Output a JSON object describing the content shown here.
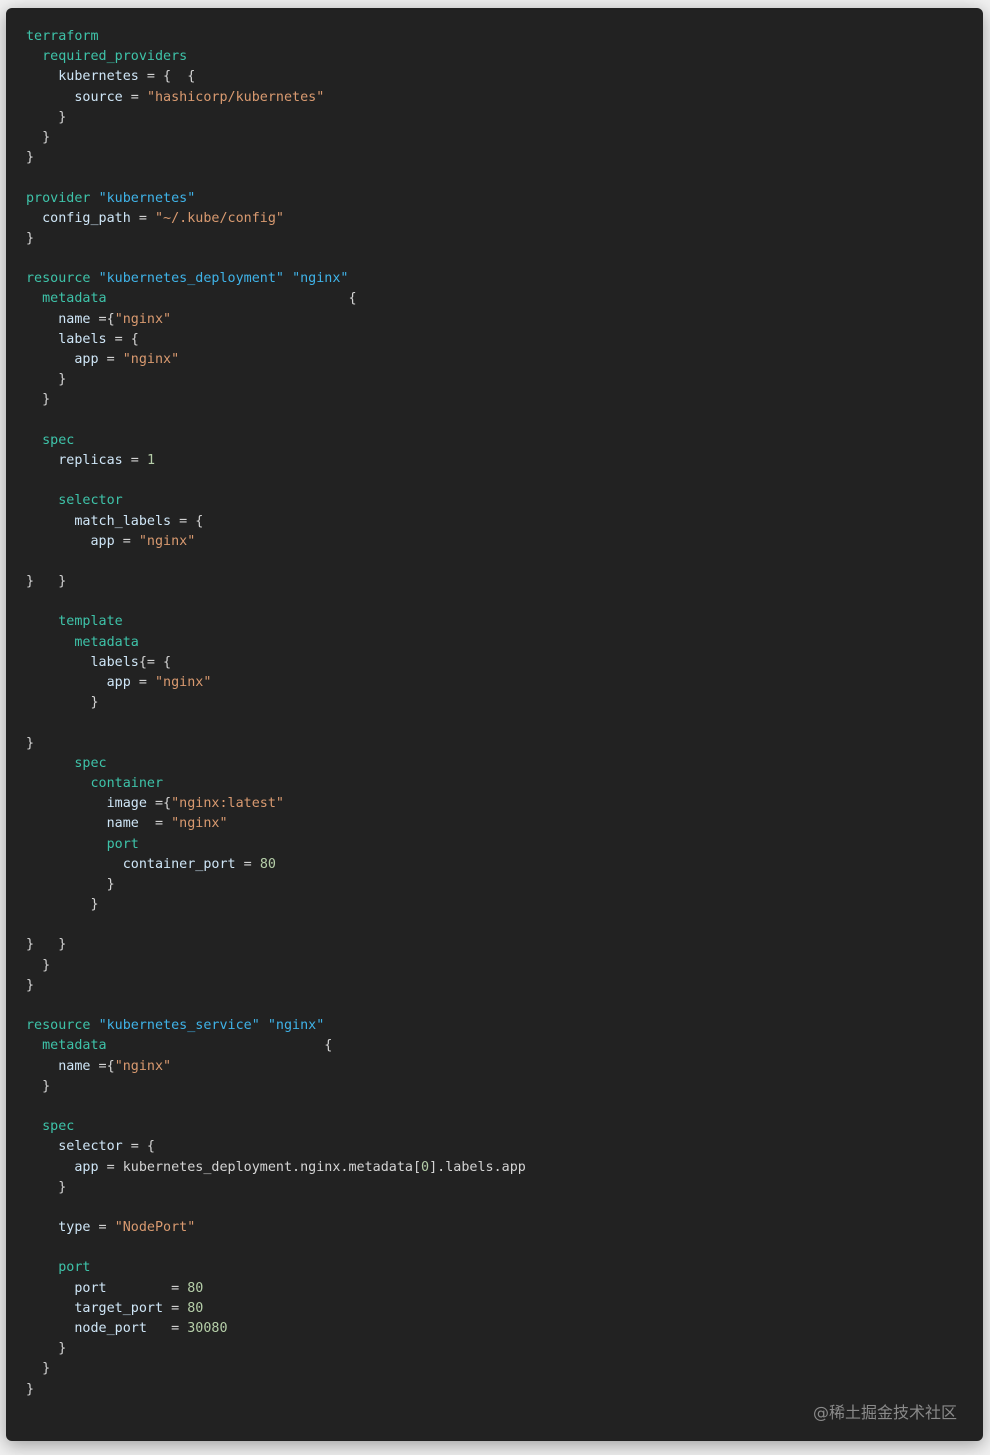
{
  "code": {
    "language": "terraform",
    "lines": [
      [
        {
          "t": "terraform",
          "c": "kw"
        }
      ],
      [
        {
          "t": "  "
        },
        {
          "t": "required_providers",
          "c": "kw"
        }
      ],
      [
        {
          "t": "    "
        },
        {
          "t": "kubernetes",
          "c": "id"
        },
        {
          "t": " = {  {",
          "c": "p"
        }
      ],
      [
        {
          "t": "      "
        },
        {
          "t": "source",
          "c": "id"
        },
        {
          "t": " = ",
          "c": "p"
        },
        {
          "t": "\"hashicorp/kubernetes\"",
          "c": "str"
        }
      ],
      [
        {
          "t": "    }",
          "c": "p"
        }
      ],
      [
        {
          "t": "  }",
          "c": "p"
        }
      ],
      [
        {
          "t": "}",
          "c": "p"
        }
      ],
      [],
      [
        {
          "t": "provider",
          "c": "kw"
        },
        {
          "t": " "
        },
        {
          "t": "\"kubernetes\"",
          "c": "lbl"
        }
      ],
      [
        {
          "t": "  "
        },
        {
          "t": "config_path",
          "c": "id"
        },
        {
          "t": " = ",
          "c": "p"
        },
        {
          "t": "\"~/.kube/config\"",
          "c": "str"
        }
      ],
      [
        {
          "t": "}",
          "c": "p"
        }
      ],
      [],
      [
        {
          "t": "resource",
          "c": "kw"
        },
        {
          "t": " "
        },
        {
          "t": "\"kubernetes_deployment\"",
          "c": "lbl"
        },
        {
          "t": " "
        },
        {
          "t": "\"nginx\"",
          "c": "lbl"
        }
      ],
      [
        {
          "t": "  "
        },
        {
          "t": "metadata",
          "c": "kw"
        },
        {
          "t": "                              {",
          "c": "p"
        }
      ],
      [
        {
          "t": "    "
        },
        {
          "t": "name",
          "c": "id"
        },
        {
          "t": " ={",
          "c": "p"
        },
        {
          "t": "\"nginx\"",
          "c": "str"
        }
      ],
      [
        {
          "t": "    "
        },
        {
          "t": "labels",
          "c": "id"
        },
        {
          "t": " = {",
          "c": "p"
        }
      ],
      [
        {
          "t": "      "
        },
        {
          "t": "app",
          "c": "id"
        },
        {
          "t": " = ",
          "c": "p"
        },
        {
          "t": "\"nginx\"",
          "c": "str"
        }
      ],
      [
        {
          "t": "    }",
          "c": "p"
        }
      ],
      [
        {
          "t": "  }",
          "c": "p"
        }
      ],
      [],
      [
        {
          "t": "  "
        },
        {
          "t": "spec",
          "c": "kw"
        }
      ],
      [
        {
          "t": "    "
        },
        {
          "t": "replicas",
          "c": "id"
        },
        {
          "t": " = ",
          "c": "p"
        },
        {
          "t": "1",
          "c": "num"
        }
      ],
      [],
      [
        {
          "t": "    "
        },
        {
          "t": "selector",
          "c": "kw"
        }
      ],
      [
        {
          "t": "      "
        },
        {
          "t": "match_labels",
          "c": "id"
        },
        {
          "t": " = {",
          "c": "p"
        }
      ],
      [
        {
          "t": "        "
        },
        {
          "t": "app",
          "c": "id"
        },
        {
          "t": " = ",
          "c": "p"
        },
        {
          "t": "\"nginx\"",
          "c": "str"
        }
      ],
      [],
      [
        {
          "t": "}   }",
          "c": "p"
        }
      ],
      [],
      [
        {
          "t": "    "
        },
        {
          "t": "template",
          "c": "kw"
        }
      ],
      [
        {
          "t": "      "
        },
        {
          "t": "metadata",
          "c": "kw"
        }
      ],
      [
        {
          "t": "        "
        },
        {
          "t": "labels",
          "c": "id"
        },
        {
          "t": "{= {",
          "c": "p"
        }
      ],
      [
        {
          "t": "          "
        },
        {
          "t": "app",
          "c": "id"
        },
        {
          "t": " = ",
          "c": "p"
        },
        {
          "t": "\"nginx\"",
          "c": "str"
        }
      ],
      [
        {
          "t": "        }",
          "c": "p"
        }
      ],
      [],
      [
        {
          "t": "}",
          "c": "p"
        }
      ],
      [
        {
          "t": "      "
        },
        {
          "t": "spec",
          "c": "kw"
        }
      ],
      [
        {
          "t": "        "
        },
        {
          "t": "container",
          "c": "kw"
        }
      ],
      [
        {
          "t": "          "
        },
        {
          "t": "image",
          "c": "id"
        },
        {
          "t": " ={",
          "c": "p"
        },
        {
          "t": "\"nginx:latest\"",
          "c": "str"
        }
      ],
      [
        {
          "t": "          "
        },
        {
          "t": "name",
          "c": "id"
        },
        {
          "t": "  = ",
          "c": "p"
        },
        {
          "t": "\"nginx\"",
          "c": "str"
        }
      ],
      [
        {
          "t": "          "
        },
        {
          "t": "port",
          "c": "kw"
        }
      ],
      [
        {
          "t": "            "
        },
        {
          "t": "container_port",
          "c": "id"
        },
        {
          "t": " = ",
          "c": "p"
        },
        {
          "t": "80",
          "c": "num"
        }
      ],
      [
        {
          "t": "          }",
          "c": "p"
        }
      ],
      [
        {
          "t": "        }",
          "c": "p"
        }
      ],
      [],
      [
        {
          "t": "}   }",
          "c": "p"
        }
      ],
      [
        {
          "t": "  }",
          "c": "p"
        }
      ],
      [
        {
          "t": "}",
          "c": "p"
        }
      ],
      [],
      [
        {
          "t": "resource",
          "c": "kw"
        },
        {
          "t": " "
        },
        {
          "t": "\"kubernetes_service\"",
          "c": "lbl"
        },
        {
          "t": " "
        },
        {
          "t": "\"nginx\"",
          "c": "lbl"
        }
      ],
      [
        {
          "t": "  "
        },
        {
          "t": "metadata",
          "c": "kw"
        },
        {
          "t": "                           {",
          "c": "p"
        }
      ],
      [
        {
          "t": "    "
        },
        {
          "t": "name",
          "c": "id"
        },
        {
          "t": " ={",
          "c": "p"
        },
        {
          "t": "\"nginx\"",
          "c": "str"
        }
      ],
      [
        {
          "t": "  }",
          "c": "p"
        }
      ],
      [],
      [
        {
          "t": "  "
        },
        {
          "t": "spec",
          "c": "kw"
        }
      ],
      [
        {
          "t": "    "
        },
        {
          "t": "selector",
          "c": "id"
        },
        {
          "t": " = {",
          "c": "p"
        }
      ],
      [
        {
          "t": "      "
        },
        {
          "t": "app",
          "c": "id"
        },
        {
          "t": " = kubernetes_deployment.nginx.metadata[",
          "c": "p"
        },
        {
          "t": "0",
          "c": "num"
        },
        {
          "t": "].labels.app",
          "c": "p"
        }
      ],
      [
        {
          "t": "    }",
          "c": "p"
        }
      ],
      [],
      [
        {
          "t": "    "
        },
        {
          "t": "type",
          "c": "id"
        },
        {
          "t": " = ",
          "c": "p"
        },
        {
          "t": "\"NodePort\"",
          "c": "str"
        }
      ],
      [],
      [
        {
          "t": "    "
        },
        {
          "t": "port",
          "c": "kw"
        }
      ],
      [
        {
          "t": "      "
        },
        {
          "t": "port",
          "c": "id"
        },
        {
          "t": "        = ",
          "c": "p"
        },
        {
          "t": "80",
          "c": "num"
        }
      ],
      [
        {
          "t": "      "
        },
        {
          "t": "target_port",
          "c": "id"
        },
        {
          "t": " = ",
          "c": "p"
        },
        {
          "t": "80",
          "c": "num"
        }
      ],
      [
        {
          "t": "      "
        },
        {
          "t": "node_port",
          "c": "id"
        },
        {
          "t": "   = ",
          "c": "p"
        },
        {
          "t": "30080",
          "c": "num"
        }
      ],
      [
        {
          "t": "    }",
          "c": "p"
        }
      ],
      [
        {
          "t": "  }",
          "c": "p"
        }
      ],
      [
        {
          "t": "}",
          "c": "p"
        }
      ]
    ]
  },
  "watermark": "@稀土掘金技术社区",
  "colors": {
    "background": "#222222",
    "keyword": "#3ec3a9",
    "string": "#d99a70",
    "label": "#3fb3e8",
    "identifier": "#cfe6f7",
    "number": "#b5cea8"
  }
}
